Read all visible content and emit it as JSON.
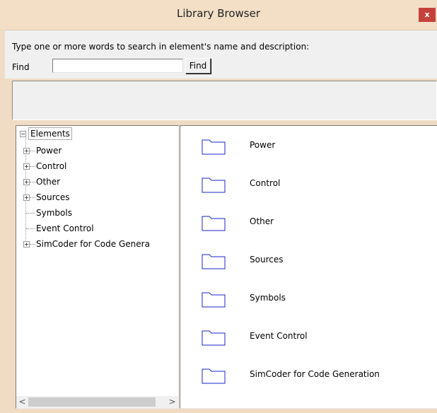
{
  "window": {
    "title": "Library Browser",
    "close_label": "x"
  },
  "search": {
    "instruction": "Type one or more words to search in element's name and  description:",
    "find_label": "Find",
    "find_value": "",
    "find_button": "Find"
  },
  "tree": {
    "root": {
      "label": "Elements",
      "expander": "−"
    },
    "items": [
      {
        "label": "Power",
        "expander": "+"
      },
      {
        "label": "Control",
        "expander": "+"
      },
      {
        "label": "Other",
        "expander": "+"
      },
      {
        "label": "Sources",
        "expander": "+"
      },
      {
        "label": "Symbols",
        "expander": ""
      },
      {
        "label": "Event Control",
        "expander": ""
      },
      {
        "label": "SimCoder for Code Genera",
        "expander": "+"
      }
    ],
    "scroll_left": "<",
    "scroll_right": ">"
  },
  "list": {
    "icon": "folder-icon",
    "items": [
      {
        "label": "Power"
      },
      {
        "label": "Control"
      },
      {
        "label": "Other"
      },
      {
        "label": "Sources"
      },
      {
        "label": "Symbols"
      },
      {
        "label": "Event Control"
      },
      {
        "label": "SimCoder for Code Generation"
      }
    ]
  },
  "colors": {
    "titlebar": "#f2dfc6",
    "close": "#c7413c",
    "folder_stroke": "#1a24c8"
  }
}
